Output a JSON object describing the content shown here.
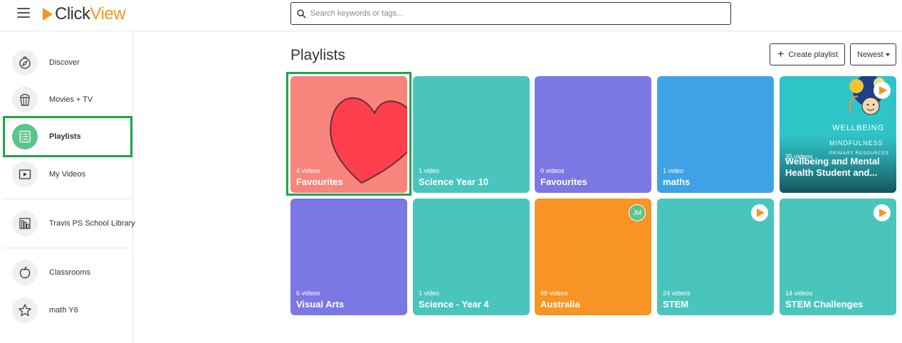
{
  "header": {
    "logo_part1": "Click",
    "logo_part2": "View",
    "search_placeholder": "Search keywords or tags..."
  },
  "sidebar": {
    "items": [
      {
        "label": "Discover",
        "icon": "compass-icon"
      },
      {
        "label": "Movies + TV",
        "icon": "popcorn-icon"
      },
      {
        "label": "Playlists",
        "icon": "playlist-icon",
        "active": true
      },
      {
        "label": "My Videos",
        "icon": "video-icon"
      },
      {
        "label": "Travis PS School Library",
        "icon": "library-icon"
      },
      {
        "label": "Classrooms",
        "icon": "apple-icon"
      },
      {
        "label": "math Y6",
        "icon": "star-icon"
      }
    ]
  },
  "main": {
    "title": "Playlists",
    "create_label": "Create playlist",
    "sort_label": "Newest",
    "cards": [
      {
        "count": "4 videos",
        "title": "Favourites",
        "color": "#f7857d",
        "selected": true
      },
      {
        "count": "1 video",
        "title": "Science Year 10",
        "color": "#4ac5bd"
      },
      {
        "count": "0 videos",
        "title": "Favourites",
        "color": "#7b78e4"
      },
      {
        "count": "1 video",
        "title": "maths",
        "color": "#3fa2e6"
      },
      {
        "count": "35 videos",
        "title": "Wellbeing and Mental Health Student and...",
        "color": "#2fc4c8",
        "thumb_text": [
          "WELLBEING",
          "MINDFULNESS",
          "PRIMARY RESOURCES"
        ]
      },
      {
        "count": "6 videos",
        "title": "Visual Arts",
        "color": "#7b78e4"
      },
      {
        "count": "1 video",
        "title": "Science - Year 4",
        "color": "#4ac5bd"
      },
      {
        "count": "68 videos",
        "title": "Australia",
        "color": "#f79423",
        "avatar": "JM"
      },
      {
        "count": "24 videos",
        "title": "STEM",
        "color": "#4ac5bd",
        "play": true
      },
      {
        "count": "14 videos",
        "title": "STEM Challenges",
        "color": "#4ac5bd",
        "play": true
      }
    ]
  },
  "colors": {
    "accent_orange": "#f7941d",
    "selection_green": "#1ea64a",
    "active_icon_bg": "#5cc58c"
  }
}
